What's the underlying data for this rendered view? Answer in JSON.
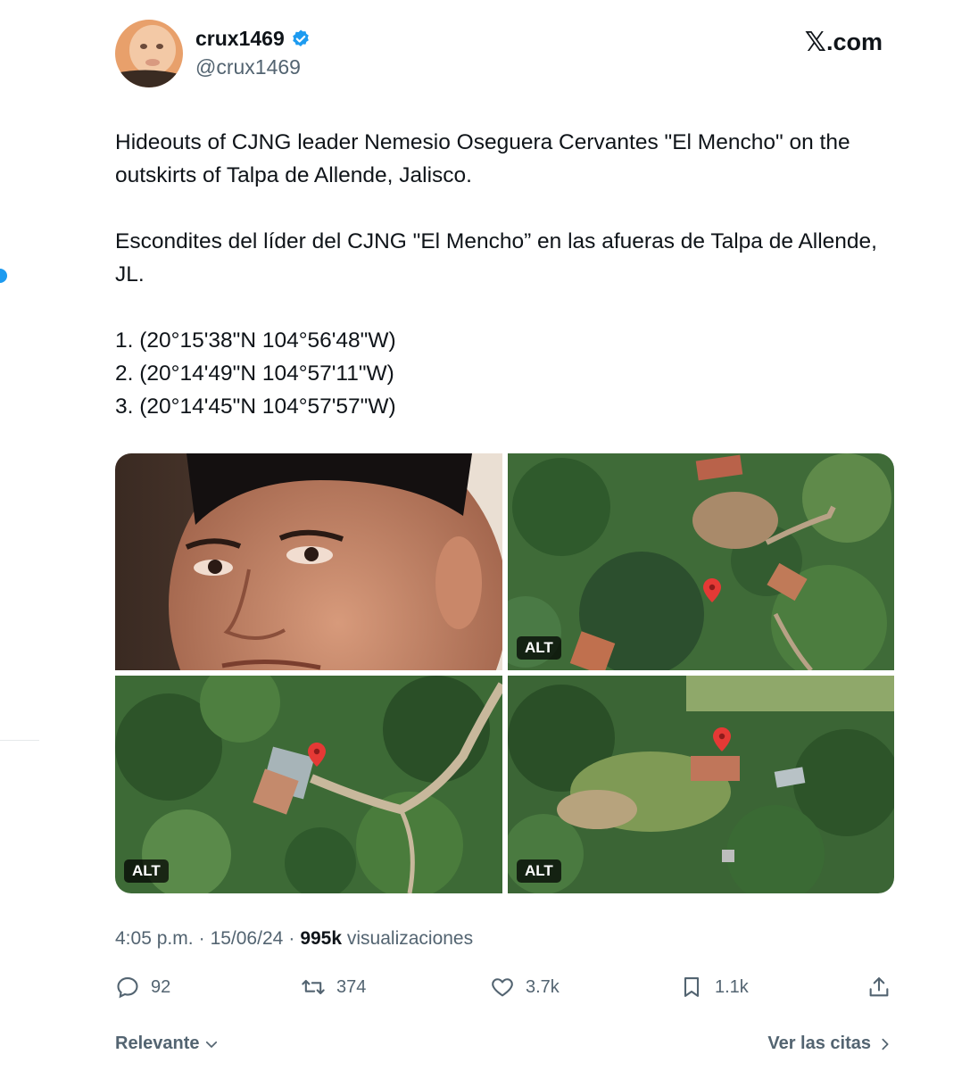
{
  "author": {
    "display_name": "crux1469",
    "handle": "@crux1469",
    "verified": true
  },
  "brand": {
    "x_glyph": "𝕏",
    "suffix": ".com"
  },
  "tweet": {
    "lines": [
      "Hideouts of CJNG leader Nemesio Oseguera Cervantes \"El Mencho\" on the outskirts of Talpa de Allende, Jalisco.",
      "Escondites del líder del CJNG \"El Mencho” en las afueras de Talpa de Allende, JL.",
      "1. (20°15'38\"N 104°56'48\"W)",
      "2. (20°14'49\"N 104°57'11\"W)",
      "3. (20°14'45\"N 104°57'57\"W)"
    ]
  },
  "media": {
    "alt_label": "ALT"
  },
  "meta": {
    "time": "4:05 p.m.",
    "separator": "·",
    "date": "15/06/24",
    "views_count": "995k",
    "views_label": "visualizaciones"
  },
  "actions": {
    "replies": "92",
    "reposts": "374",
    "likes": "3.7k",
    "bookmarks": "1.1k"
  },
  "footer": {
    "sort_label": "Relevante",
    "quotes_label": "Ver las citas"
  },
  "colors": {
    "text_primary": "#0f1419",
    "text_secondary": "#536471",
    "accent": "#1d9bf0",
    "map_pin": "#e53935"
  }
}
